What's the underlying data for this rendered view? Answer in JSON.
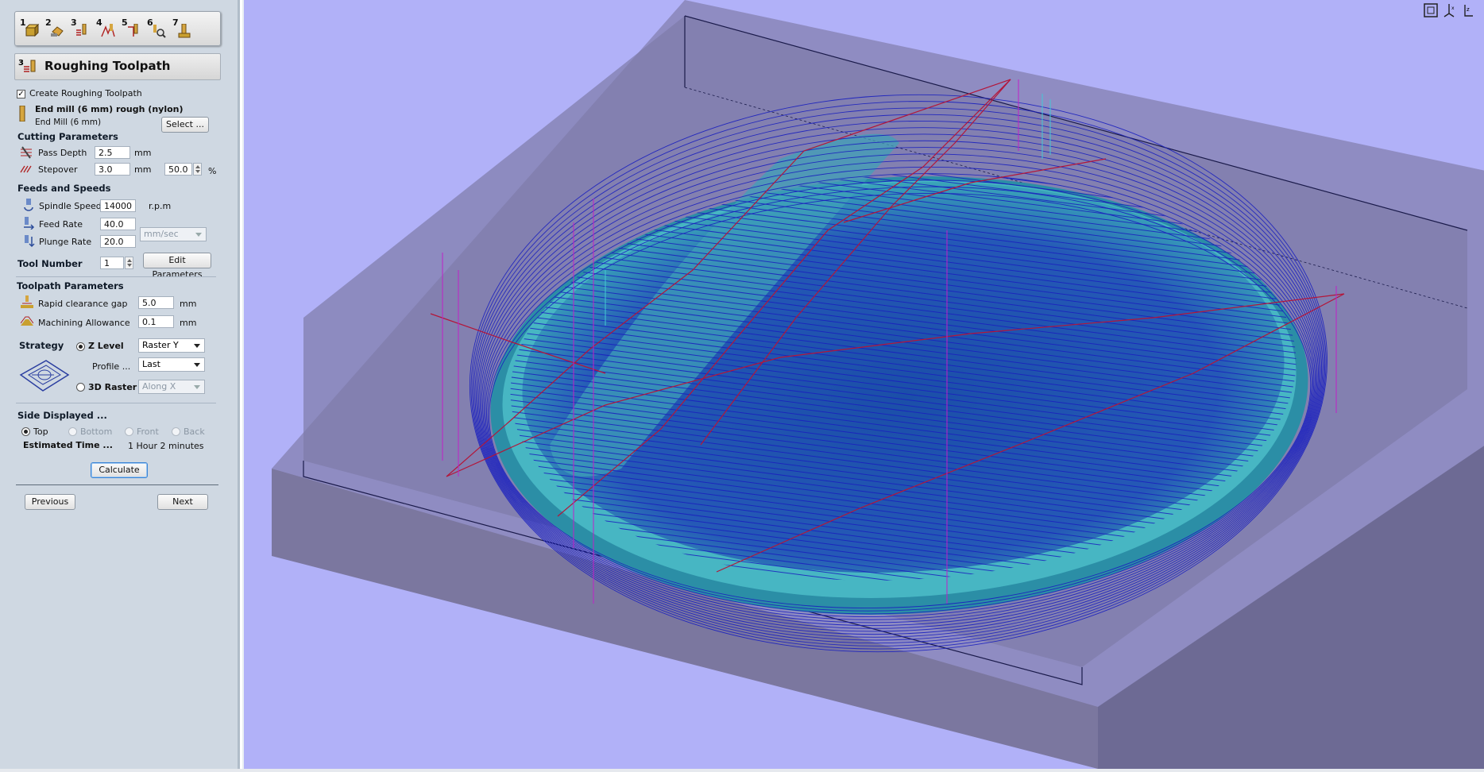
{
  "toolbar": {
    "buttons": [
      {
        "num": "1",
        "icon": "create-material-icon"
      },
      {
        "num": "2",
        "icon": "tool-holder-icon"
      },
      {
        "num": "3",
        "icon": "roughing-toolpath-icon"
      },
      {
        "num": "4",
        "icon": "finishing-toolpath-icon"
      },
      {
        "num": "5",
        "icon": "cutout-toolpath-icon"
      },
      {
        "num": "6",
        "icon": "preview-toolpath-icon"
      },
      {
        "num": "7",
        "icon": "save-toolpath-icon"
      }
    ]
  },
  "panel": {
    "title_num": "3",
    "title": "Roughing Toolpath",
    "create_label": "Create Roughing Toolpath",
    "create_checked": true,
    "tool_name": "End mill (6 mm) rough (nylon)",
    "tool_sub": "End Mill (6 mm)",
    "select_label": "Select ...",
    "cutting_header": "Cutting Parameters",
    "pass_depth_label": "Pass Depth",
    "pass_depth_value": "2.5",
    "pass_depth_unit": "mm",
    "stepover_label": "Stepover",
    "stepover_value": "3.0",
    "stepover_unit": "mm",
    "stepover_percent": "50.0",
    "percent_sign": "%",
    "feeds_header": "Feeds and Speeds",
    "spindle_label": "Spindle Speed",
    "spindle_value": "14000",
    "spindle_unit": "r.p.m",
    "feed_label": "Feed Rate",
    "feed_value": "40.0",
    "plunge_label": "Plunge Rate",
    "plunge_value": "20.0",
    "rate_unit": "mm/sec",
    "tool_number_label": "Tool Number",
    "tool_number_value": "1",
    "edit_params_label": "Edit Parameters",
    "toolpath_header": "Toolpath Parameters",
    "rapid_label": "Rapid clearance gap",
    "rapid_value": "5.0",
    "rapid_unit": "mm",
    "allowance_label": "Machining Allowance",
    "allowance_value": "0.1",
    "allowance_unit": "mm",
    "strategy_label": "Strategy",
    "zlevel_label": "Z Level",
    "zlevel_selected": true,
    "zlevel_option": "Raster Y",
    "profile_label": "Profile ...",
    "profile_option": "Last",
    "raster3d_label": "3D Raster",
    "raster3d_option": "Along X",
    "side_header": "Side Displayed ...",
    "side_top": "Top",
    "side_bottom": "Bottom",
    "side_front": "Front",
    "side_back": "Back",
    "est_label": "Estimated Time ...",
    "est_value": "1 Hour 2 minutes",
    "calculate_label": "Calculate",
    "previous_label": "Previous",
    "next_label": "Next"
  },
  "viewport": {
    "view_icons": [
      "zoom-extents-icon",
      "rotate-x-icon",
      "rotate-z-icon"
    ],
    "colors": {
      "background": "#b1b1f8",
      "block_top": "#8a86b8",
      "block_side": "#75719e",
      "toolpath": "#1a1fbf",
      "rapid": "#b3163a",
      "plunge": "#c020c8",
      "part": "#3aa6b8"
    }
  }
}
